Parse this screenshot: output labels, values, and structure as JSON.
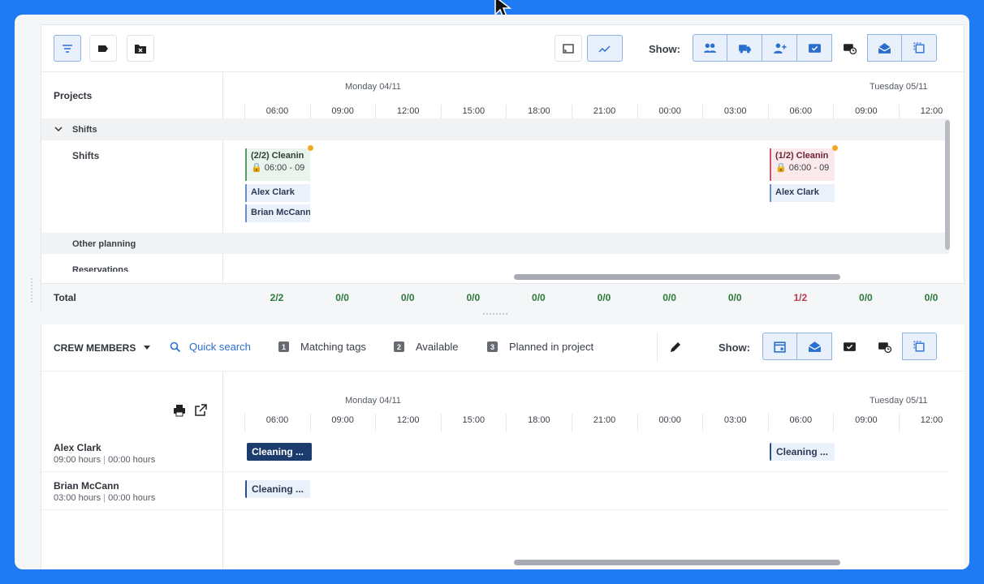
{
  "colors": {
    "background": "#1f7bf2",
    "accent": "#2a6fd0",
    "active_button": "#e7f0fb",
    "green_total": "#2a7a3a",
    "red_total": "#b23a4d",
    "shift_dot": "#f5a623"
  },
  "top_toolbar": {
    "left_buttons": [
      {
        "icon": "filter-icon",
        "active": true
      },
      {
        "icon": "tag-icon",
        "active": false
      },
      {
        "icon": "folder-remove-icon",
        "active": false
      }
    ],
    "view_buttons": [
      {
        "icon": "fit-screen-icon",
        "active": false
      },
      {
        "icon": "chart-trend-icon",
        "active": true
      }
    ],
    "show_label": "Show:",
    "show_buttons": [
      {
        "icon": "group-icon",
        "active": true
      },
      {
        "icon": "truck-icon",
        "active": true
      },
      {
        "icon": "person-add-icon",
        "active": true
      },
      {
        "icon": "mail-check-icon",
        "active": true
      },
      {
        "icon": "mail-clock-icon",
        "active": false
      },
      {
        "icon": "mail-open-icon",
        "active": true
      },
      {
        "icon": "copy-icon",
        "active": true
      }
    ]
  },
  "planner": {
    "projects_title": "Projects",
    "day1": "Monday 04/11",
    "day2": "Tuesday 05/11",
    "hours": [
      "06:00",
      "09:00",
      "12:00",
      "15:00",
      "18:00",
      "21:00",
      "00:00",
      "03:00",
      "06:00",
      "09:00",
      "12:00"
    ],
    "shifts_group": "Shifts",
    "shifts_row": "Shifts",
    "other_group": "Other planning",
    "reservations": "Reservations",
    "shift_cards": [
      {
        "title": "(2/2) Cleanin",
        "time": "06:00 - 09",
        "status": "complete",
        "people": [
          "Alex Clark",
          "Brian McCann"
        ]
      },
      {
        "title": "(1/2) Cleanin",
        "time": "06:00 - 09",
        "status": "incomplete",
        "people": [
          "Alex Clark"
        ]
      }
    ],
    "total_label": "Total",
    "totals": [
      "2/2",
      "0/0",
      "0/0",
      "0/0",
      "0/0",
      "0/0",
      "0/0",
      "0/0",
      "1/2",
      "0/0",
      "0/0"
    ]
  },
  "crew": {
    "title": "CREW MEMBERS",
    "quick_search": "Quick search",
    "legend": [
      {
        "num": "1",
        "label": "Matching tags"
      },
      {
        "num": "2",
        "label": "Available"
      },
      {
        "num": "3",
        "label": "Planned in project"
      }
    ],
    "show_label": "Show:",
    "show_buttons": [
      {
        "icon": "calendar-icon",
        "active": true
      },
      {
        "icon": "mail-open-icon",
        "active": true
      },
      {
        "icon": "mail-check-icon",
        "active": false
      },
      {
        "icon": "mail-clock-icon",
        "active": false
      },
      {
        "icon": "copy-icon",
        "active": true
      }
    ],
    "day1": "Monday 04/11",
    "day2": "Tuesday 05/11",
    "hours": [
      "06:00",
      "09:00",
      "12:00",
      "15:00",
      "18:00",
      "21:00",
      "00:00",
      "03:00",
      "06:00",
      "09:00",
      "12:00"
    ],
    "members": [
      {
        "name": "Alex Clark",
        "hours": "09:00 hours",
        "sep": "|",
        "hours2": "00:00 hours",
        "tasks": [
          "Cleaning ...",
          "Cleaning ..."
        ]
      },
      {
        "name": "Brian McCann",
        "hours": "03:00 hours",
        "sep": "|",
        "hours2": "00:00 hours",
        "tasks": [
          "Cleaning ..."
        ]
      }
    ]
  }
}
